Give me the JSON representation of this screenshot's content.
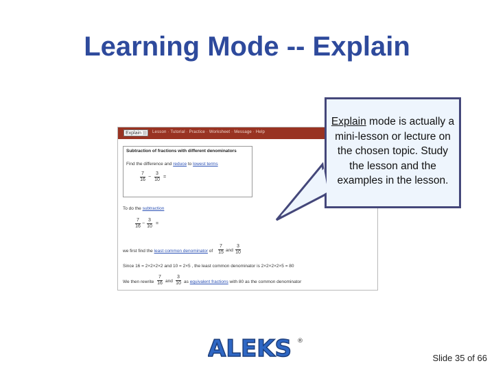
{
  "slide": {
    "title": "Learning Mode -- Explain",
    "footer": "Slide 35 of 66"
  },
  "callout": {
    "emphasis": "Explain",
    "text": " mode is actually a mini-lesson or lecture on the chosen topic. Study the lesson and the examples in the lesson."
  },
  "logo": {
    "text": "ALEKS",
    "mark": "®"
  },
  "screenshot": {
    "select_value": "Explain",
    "menu_text": "Lesson · Tutorial · Practice · Worksheet · Message · Help",
    "box_title": "Subtraction of fractions with different denominators",
    "instruction_prefix": "Find the difference and ",
    "instruction_link1": "reduce",
    "instruction_mid": " to ",
    "instruction_link2": "lowest terms",
    "lesson_prefix": "To do the ",
    "lesson_link": "subtraction",
    "find_lcd_prefix": "we first find the ",
    "find_lcd_link": "least common denominator",
    "find_lcd_suffix": " of",
    "find_lcd_and": "and",
    "since_text": "Since 16 = 2×2×2×2 and 10 = 2×5 , the least common denominator is 2×2×2×2×5 = 80",
    "rewrite_prefix": "We then rewrite",
    "rewrite_and": "and",
    "rewrite_as": "as",
    "rewrite_link": "equivalent fractions",
    "rewrite_with": "with",
    "rewrite_num": "80",
    "rewrite_suffix": "as the common denominator",
    "frac_a_num": "7",
    "frac_a_den": "16",
    "frac_b_num": "3",
    "frac_b_den": "10",
    "frac_c_num": "7",
    "frac_c_den": "15",
    "minus": "−",
    "equals": "="
  }
}
